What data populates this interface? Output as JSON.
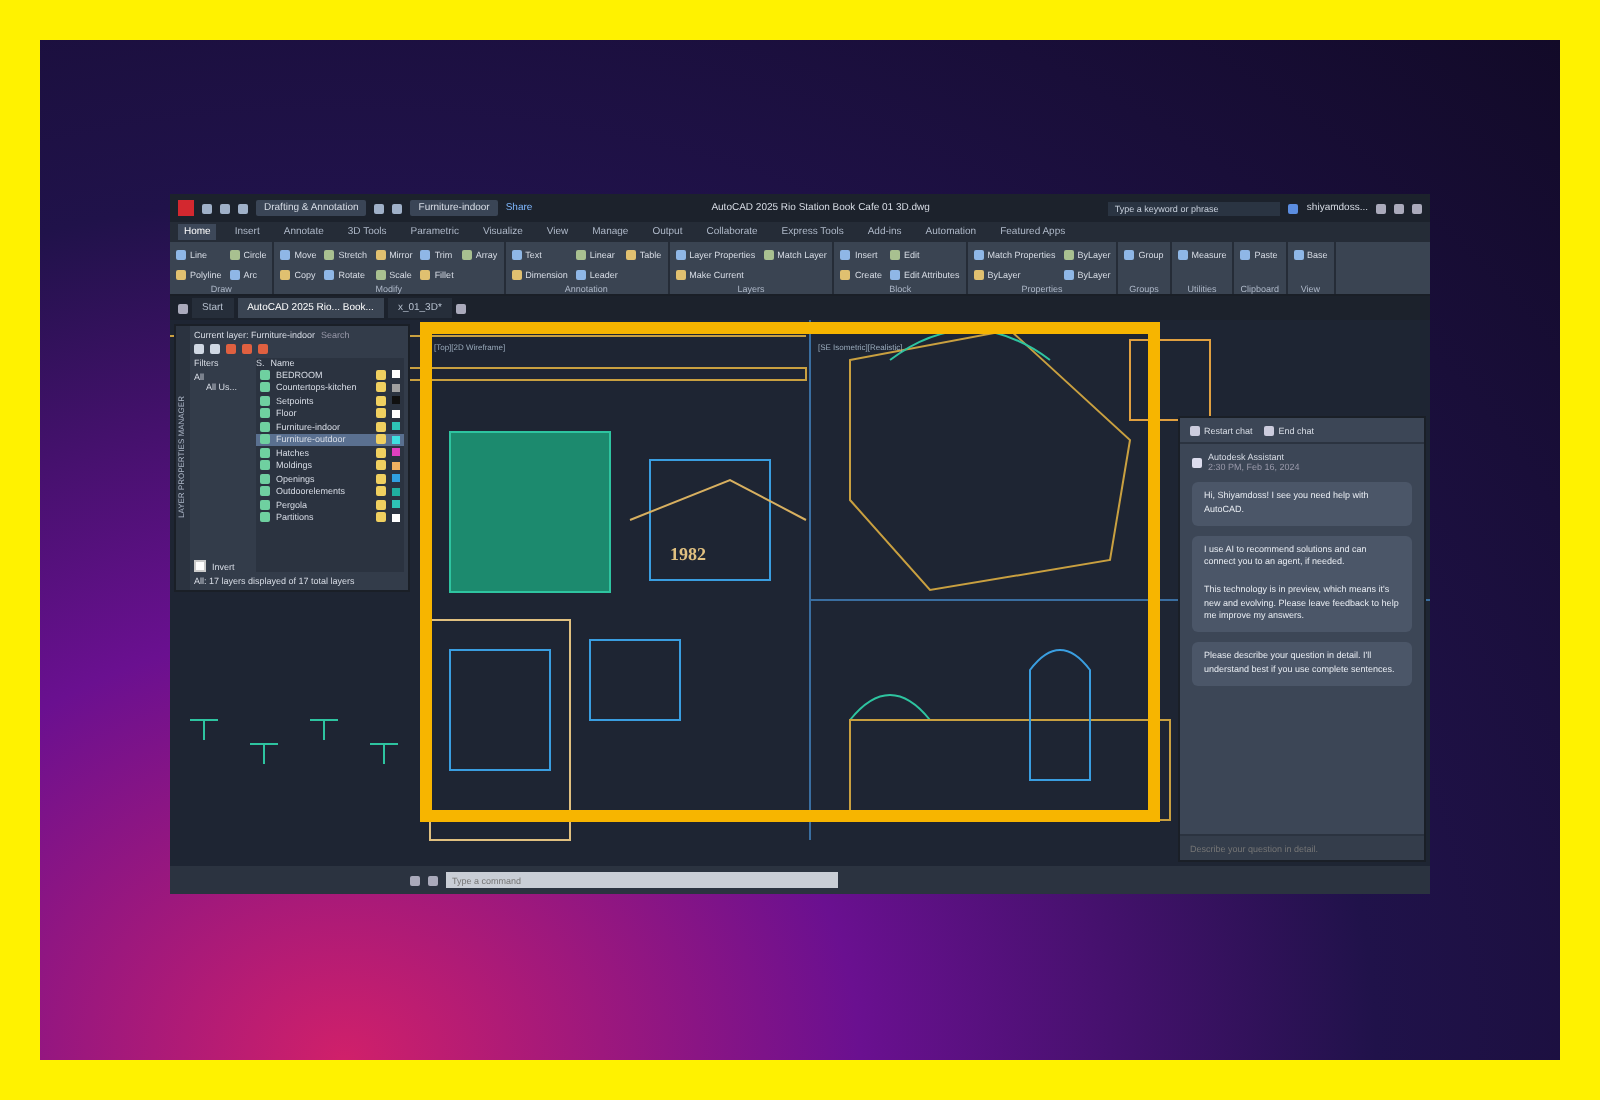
{
  "window": {
    "title": "AutoCAD 2025 Rio Station Book Cafe 01 3D.dwg",
    "workspace": "Drafting & Annotation",
    "layer_dropdown": "Furniture-indoor",
    "share": "Share",
    "search": {
      "placeholder": "Type a keyword or phrase"
    },
    "user": "shiyamdoss..."
  },
  "ribbon_tabs": [
    {
      "label": "Home",
      "selected": true
    },
    {
      "label": "Insert",
      "selected": false
    },
    {
      "label": "Annotate",
      "selected": false
    },
    {
      "label": "3D Tools",
      "selected": false
    },
    {
      "label": "Parametric",
      "selected": false
    },
    {
      "label": "Visualize",
      "selected": false
    },
    {
      "label": "View",
      "selected": false
    },
    {
      "label": "Manage",
      "selected": false
    },
    {
      "label": "Output",
      "selected": false
    },
    {
      "label": "Collaborate",
      "selected": false
    },
    {
      "label": "Express Tools",
      "selected": false
    },
    {
      "label": "Add-ins",
      "selected": false
    },
    {
      "label": "Automation",
      "selected": false
    },
    {
      "label": "Featured Apps",
      "selected": false
    }
  ],
  "ribbon_groups": [
    {
      "label": "Draw",
      "tools": [
        "Line",
        "Polyline",
        "Circle",
        "Arc"
      ]
    },
    {
      "label": "Modify",
      "tools": [
        "Move",
        "Copy",
        "Stretch",
        "Rotate",
        "Mirror",
        "Scale",
        "Trim",
        "Fillet",
        "Array"
      ]
    },
    {
      "label": "Annotation",
      "tools": [
        "Text",
        "Dimension",
        "Linear",
        "Leader",
        "Table"
      ]
    },
    {
      "label": "Layers",
      "tools": [
        "Layer Properties",
        "Make Current",
        "Match Layer"
      ]
    },
    {
      "label": "Block",
      "tools": [
        "Insert",
        "Create",
        "Edit",
        "Edit Attributes"
      ]
    },
    {
      "label": "Properties",
      "tools": [
        "Match Properties",
        "ByLayer",
        "ByLayer",
        "ByLayer"
      ]
    },
    {
      "label": "Groups",
      "tools": [
        "Group"
      ]
    },
    {
      "label": "Utilities",
      "tools": [
        "Measure"
      ]
    },
    {
      "label": "Clipboard",
      "tools": [
        "Paste"
      ]
    },
    {
      "label": "View",
      "tools": [
        "Base"
      ]
    }
  ],
  "file_tabs": [
    {
      "label": "Start",
      "selected": false
    },
    {
      "label": "AutoCAD 2025 Rio... Book...",
      "selected": true
    },
    {
      "label": "x_01_3D*",
      "selected": false
    }
  ],
  "layers_palette": {
    "side_title": "LAYER PROPERTIES MANAGER",
    "current_layer": "Current layer: Furniture-indoor",
    "search": "Search",
    "filters_label": "Filters",
    "filter_tree": [
      {
        "label": "All",
        "children": [
          {
            "label": "All Us..."
          }
        ]
      }
    ],
    "invert": {
      "label": "Invert",
      "checked": false
    },
    "columns": [
      "S.",
      "Name"
    ],
    "layers": [
      {
        "name": "BEDROOM",
        "color": "#ffffff",
        "selected": false
      },
      {
        "name": "Countertops-kitchen",
        "color": "#a0a0a0",
        "selected": false
      },
      {
        "name": "Setpoints",
        "color": "#101010",
        "selected": false
      },
      {
        "name": "Floor",
        "color": "#ffffff",
        "selected": false
      },
      {
        "name": "Furniture-indoor",
        "color": "#2ec4b6",
        "selected": false
      },
      {
        "name": "Furniture-outdoor",
        "color": "#3ee0e0",
        "selected": true
      },
      {
        "name": "Hatches",
        "color": "#e040c0",
        "selected": false
      },
      {
        "name": "Moldings",
        "color": "#f0b060",
        "selected": false
      },
      {
        "name": "Openings",
        "color": "#30a0e0",
        "selected": false
      },
      {
        "name": "Outdoorelements",
        "color": "#20b0a0",
        "selected": false
      },
      {
        "name": "Pergola",
        "color": "#2ec4b6",
        "selected": false
      },
      {
        "name": "Partitions",
        "color": "#ffffff",
        "selected": false
      }
    ],
    "status": "All: 17 layers displayed of 17 total layers"
  },
  "viewports": [
    {
      "label": "[Top][2D Wireframe]"
    },
    {
      "label": "[SE Isometric][Realistic]"
    }
  ],
  "drawing_text": "1982",
  "chat": {
    "restart": "Restart chat",
    "end": "End chat",
    "sender": "Autodesk Assistant",
    "time": "2:30 PM, Feb 16, 2024",
    "messages": [
      "Hi, Shiyamdoss! I see you need help with AutoCAD.",
      "I use AI to recommend solutions and can connect you to an agent, if needed.\n\nThis technology is in preview, which means it's new and evolving. Please leave feedback to help me improve my answers.",
      "Please describe your question in detail. I'll understand best if you use complete sentences."
    ],
    "input": {
      "placeholder": "Describe your question in detail."
    }
  },
  "command_line": {
    "placeholder": "Type a command"
  }
}
